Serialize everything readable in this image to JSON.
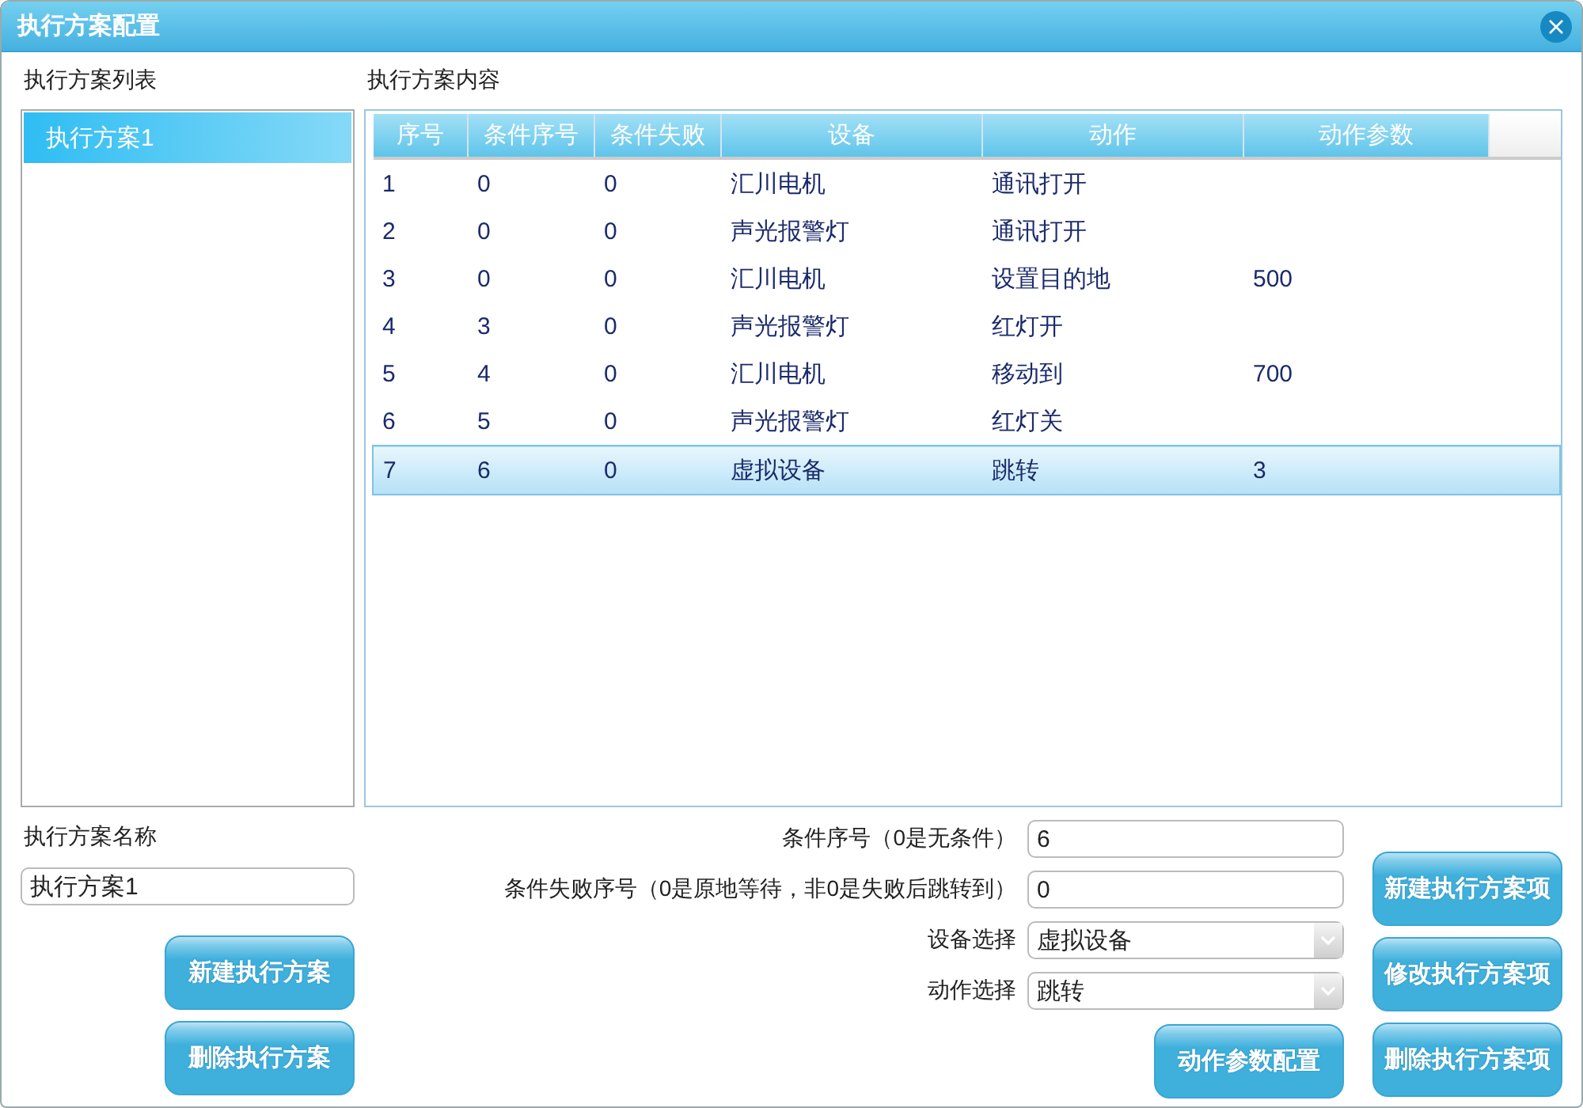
{
  "window": {
    "title": "执行方案配置"
  },
  "plan_list": {
    "heading": "执行方案列表",
    "items": [
      {
        "label": "执行方案1",
        "selected": true
      }
    ]
  },
  "plan_content": {
    "heading": "执行方案内容",
    "columns": [
      "序号",
      "条件序号",
      "条件失败",
      "设备",
      "动作",
      "动作参数"
    ],
    "rows": [
      {
        "seq": "1",
        "cond": "0",
        "fail": "0",
        "device": "汇川电机",
        "action": "通讯打开",
        "selected": false
      },
      {
        "seq": "2",
        "cond": "0",
        "fail": "0",
        "device": "声光报警灯",
        "action": "通讯打开",
        "selected": false
      },
      {
        "seq": "3",
        "cond": "0",
        "fail": "0",
        "device": "汇川电机",
        "action": "设置目的地",
        "param": "500",
        "selected": false
      },
      {
        "seq": "4",
        "cond": "3",
        "fail": "0",
        "device": "声光报警灯",
        "action": "红灯开",
        "selected": false
      },
      {
        "seq": "5",
        "cond": "4",
        "fail": "0",
        "device": "汇川电机",
        "action": "移动到",
        "param": "700",
        "selected": false
      },
      {
        "seq": "6",
        "cond": "5",
        "fail": "0",
        "device": "声光报警灯",
        "action": "红灯关",
        "selected": false
      },
      {
        "seq": "7",
        "cond": "6",
        "fail": "0",
        "device": "虚拟设备",
        "action": "跳转",
        "param": "3",
        "selected": true
      }
    ]
  },
  "plan_name": {
    "label": "执行方案名称",
    "value": "执行方案1"
  },
  "plan_buttons": [
    "新建执行方案",
    "删除执行方案"
  ],
  "form": {
    "fields": [
      {
        "kind": "text",
        "label": "条件序号（0是无条件）",
        "value": "6"
      },
      {
        "kind": "text",
        "label": "条件失败序号（0是原地等待，非0是失败后跳转到）",
        "value": "0"
      },
      {
        "kind": "select",
        "label": "设备选择",
        "value": "虚拟设备"
      },
      {
        "kind": "select",
        "label": "动作选择",
        "value": "跳转"
      }
    ],
    "button": "动作参数配置"
  },
  "item_buttons": [
    "新建执行方案项",
    "修改执行方案项",
    "删除执行方案项"
  ]
}
